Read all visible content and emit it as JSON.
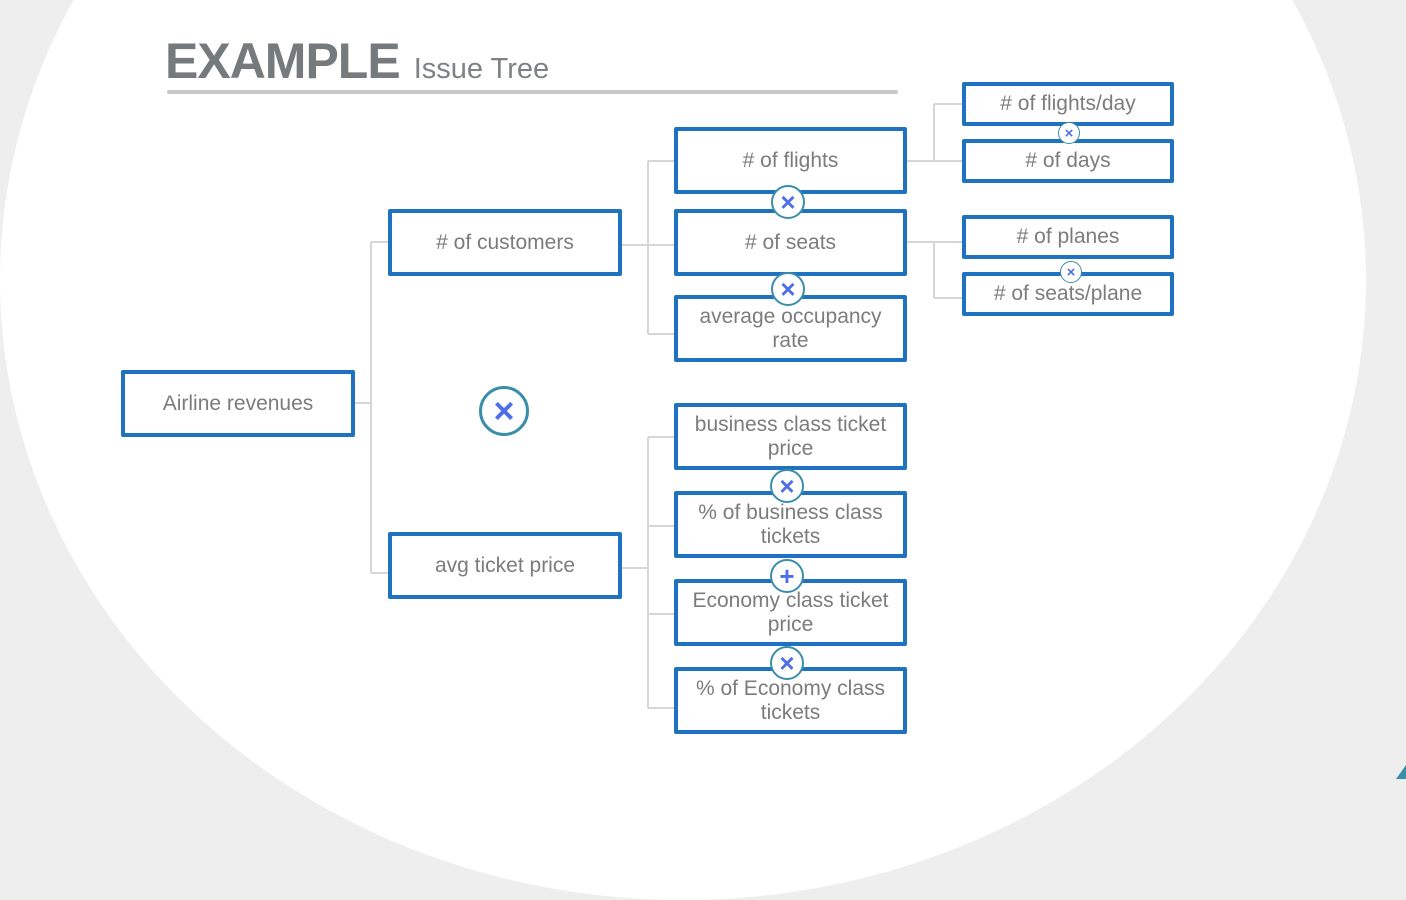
{
  "header": {
    "title": "EXAMPLE",
    "subtitle": "Issue Tree"
  },
  "colors": {
    "node_border": "#1f72c0",
    "node_text": "#7c7c7c",
    "operator_ring": "#3a8eaa",
    "operator_glyph": "#4f6fe8",
    "connector": "#d6d6d6",
    "background": "#eeeeee",
    "accent": "#3a8eaa"
  },
  "tree": {
    "root": "Airline revenues",
    "root_operator": "×",
    "level1": {
      "customers": "# of customers",
      "ticket_price": "avg ticket price"
    },
    "customers_children": {
      "flights": "# of flights",
      "op1": "×",
      "seats": "# of seats",
      "op2": "×",
      "occupancy": "average occupancy rate"
    },
    "flights_children": {
      "flights_per_day": "# of flights/day",
      "op": "×",
      "days": "# of days"
    },
    "seats_children": {
      "planes": "# of planes",
      "op": "×",
      "seats_per_plane": "# of seats/plane"
    },
    "ticket_price_children": {
      "business_price": "business class ticket price",
      "op1": "×",
      "business_pct": "% of business class tickets",
      "op2": "+",
      "economy_price": "Economy class ticket price",
      "op3": "×",
      "economy_pct": "% of Economy class tickets"
    }
  }
}
